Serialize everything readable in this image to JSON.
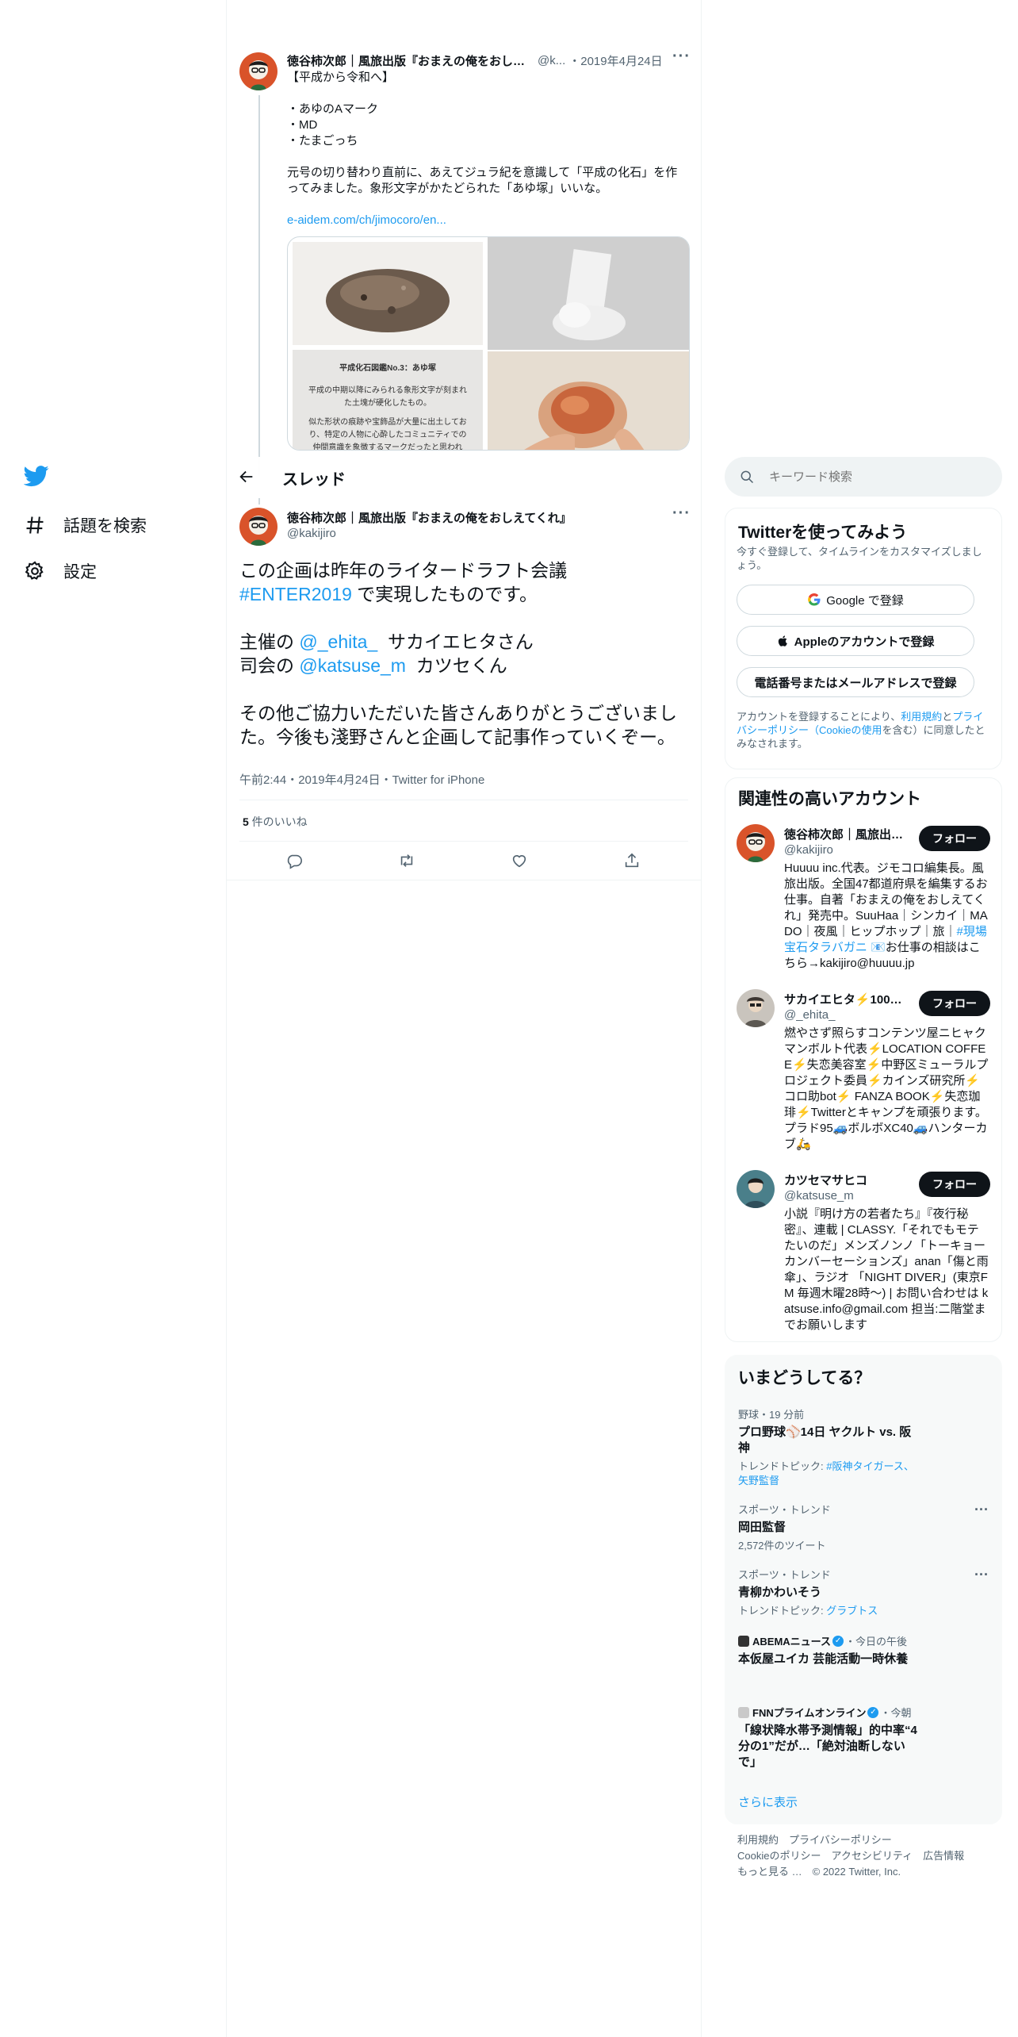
{
  "nav": {
    "explore": "話題を検索",
    "settings": "設定"
  },
  "prev_tweet": {
    "name": "徳谷柿次郎｜風旅出版『おまえの俺をおし…",
    "handle": "@k...",
    "date": "・2019年4月24日",
    "heading": "【平成から令和へ】",
    "bullet1": "・あゆのAマーク",
    "bullet2": "・MD",
    "bullet3": "・たまごっち",
    "body_line1": "元号の切り替わり直前に、あえてジュラ紀を意識して「平成の化石」を作",
    "body_line2": "ってみました。象形文字がかたどられた「あゆ塚」いいな。",
    "link": "e-aidem.com/ch/jimocoro/en...",
    "card_title": "平成化石図鑑No.3：あゆ塚",
    "card_line1": "平成の中期以降にみられる象形文字が刻まれ",
    "card_line2": "た土塊が硬化したもの。",
    "card_line3": "似た形状の痕跡や宝飾品が大量に出土してお",
    "card_line4": "り、特定の人物に心酔したコミュニティでの",
    "card_line5": "仲間意識を象徴するマークだったと思われ"
  },
  "thread": {
    "title": "スレッド"
  },
  "tweet": {
    "name": "徳谷柿次郎｜風旅出版『おまえの俺をおしえてくれ』",
    "handle": "@kakijiro",
    "line1": "この企画は昨年のライタードラフト会議",
    "hashtag": "#ENTER2019",
    "line2_rest": " で実現したものです。",
    "host_prefix": "主催の ",
    "host_mention": "@_ehita_",
    "host_suffix": "  サカイエヒタさん",
    "mc_prefix": "司会の ",
    "mc_mention": "@katsuse_m",
    "mc_suffix": "  カツセくん",
    "closing": "その他ご協力いただいた皆さんありがとうございました。今後も淺野さんと企画して記事作っていくぞー。",
    "time": "午前2:44・2019年4月24日・Twitter for iPhone",
    "likes_count": "5",
    "likes_label": " 件のいいね"
  },
  "search": {
    "placeholder": "キーワード検索"
  },
  "signup": {
    "title": "Twitterを使ってみよう",
    "subtitle": "今すぐ登録して、タイムラインをカスタマイズしましょう。",
    "google": "Google で登録",
    "apple": "Appleのアカウントで登録",
    "phone": "電話番号またはメールアドレスで登録",
    "legal_prefix": "アカウントを登録することにより、",
    "legal_terms": "利用規約",
    "legal_and": "と",
    "legal_privacy": "プライバシーポリシー（Cookieの使用",
    "legal_suffix": "を含む）に同意したとみなされます。"
  },
  "relevant": {
    "title": "関連性の高いアカウント",
    "follow_label": "フォロー",
    "accounts": [
      {
        "name": "徳谷柿次郎｜風旅出…",
        "handle": "@kakijiro",
        "bio_a": "Huuuu inc.代表。ジモコロ編集長。風旅出版。全国47都道府県を編集するお仕事。自著「おまえの俺をおしえてくれ」発売中。SuuHaa｜シンカイ｜MADO｜夜風｜ヒップホップ｜旅｜",
        "bio_link": "#現場宝石タラバガニ",
        "bio_b": " 📧お仕事の相談はこちら→kakijiro@huuuu.jp"
      },
      {
        "name": "サカイエヒタ⚡️100…",
        "handle": "@_ehita_",
        "bio_a": "燃やさず照らすコンテンツ屋ニヒャクマンボルト代表⚡️LOCATION COFFEE⚡️失恋美容室⚡️中野区ミューラルプロジェクト委員⚡️カインズ研究所⚡️コロ助bot⚡️ FANZA BOOK⚡️失恋珈琲⚡️Twitterとキャンプを頑張ります。プラド95🚙ボルボXC40🚙ハンターカブ🛵"
      },
      {
        "name": "カツセマサヒコ",
        "handle": "@katsuse_m",
        "bio_a": "小説『明け方の若者たち』『夜行秘密』、連載 | CLASSY.「それでもモテたいのだ」メンズノンノ「トーキョーカンバーセーションズ」anan「傷と雨傘」、ラジオ 「NIGHT DIVER」(東京FM 毎週木曜28時〜) | お問い合わせは katsuse.info@gmail.com 担当:二階堂までお願いします"
      }
    ]
  },
  "trends": {
    "title": "いまどうしてる？",
    "items": [
      {
        "meta": "野球・19 分前",
        "title": "プロ野球⚾️14日 ヤクルト vs. 阪神",
        "sub_prefix": "トレンドトピック: ",
        "sub_link": "#阪神タイガース、矢野監督"
      },
      {
        "meta": "スポーツ・トレンド",
        "title": "岡田監督",
        "sub": "2,572件のツイート"
      },
      {
        "meta": "スポーツ・トレンド",
        "title": "青柳かわいそう",
        "sub_prefix": "トレンドトピック: ",
        "sub_link": "グラブトス"
      },
      {
        "source": "ABEMAニュース",
        "meta": "・今日の午後",
        "title": "本仮屋ユイカ 芸能活動一時休養"
      },
      {
        "source": "FNNプライムオンライン",
        "meta": "・今朝",
        "title": "「線状降水帯予測情報」的中率“4分の1”だが…「絶対油断しないで」"
      }
    ],
    "show_more": "さらに表示"
  },
  "footer": {
    "terms": "利用規約",
    "privacy": "プライバシーポリシー",
    "cookie": "Cookieのポリシー",
    "accessibility": "アクセシビリティ",
    "ads": "広告情報",
    "more": "もっと見る …",
    "copyright": "© 2022 Twitter, Inc."
  },
  "colors": {
    "accent": "#1d9bf0",
    "text": "#0f1419",
    "secondary": "#536471",
    "border": "#eff3f4"
  }
}
